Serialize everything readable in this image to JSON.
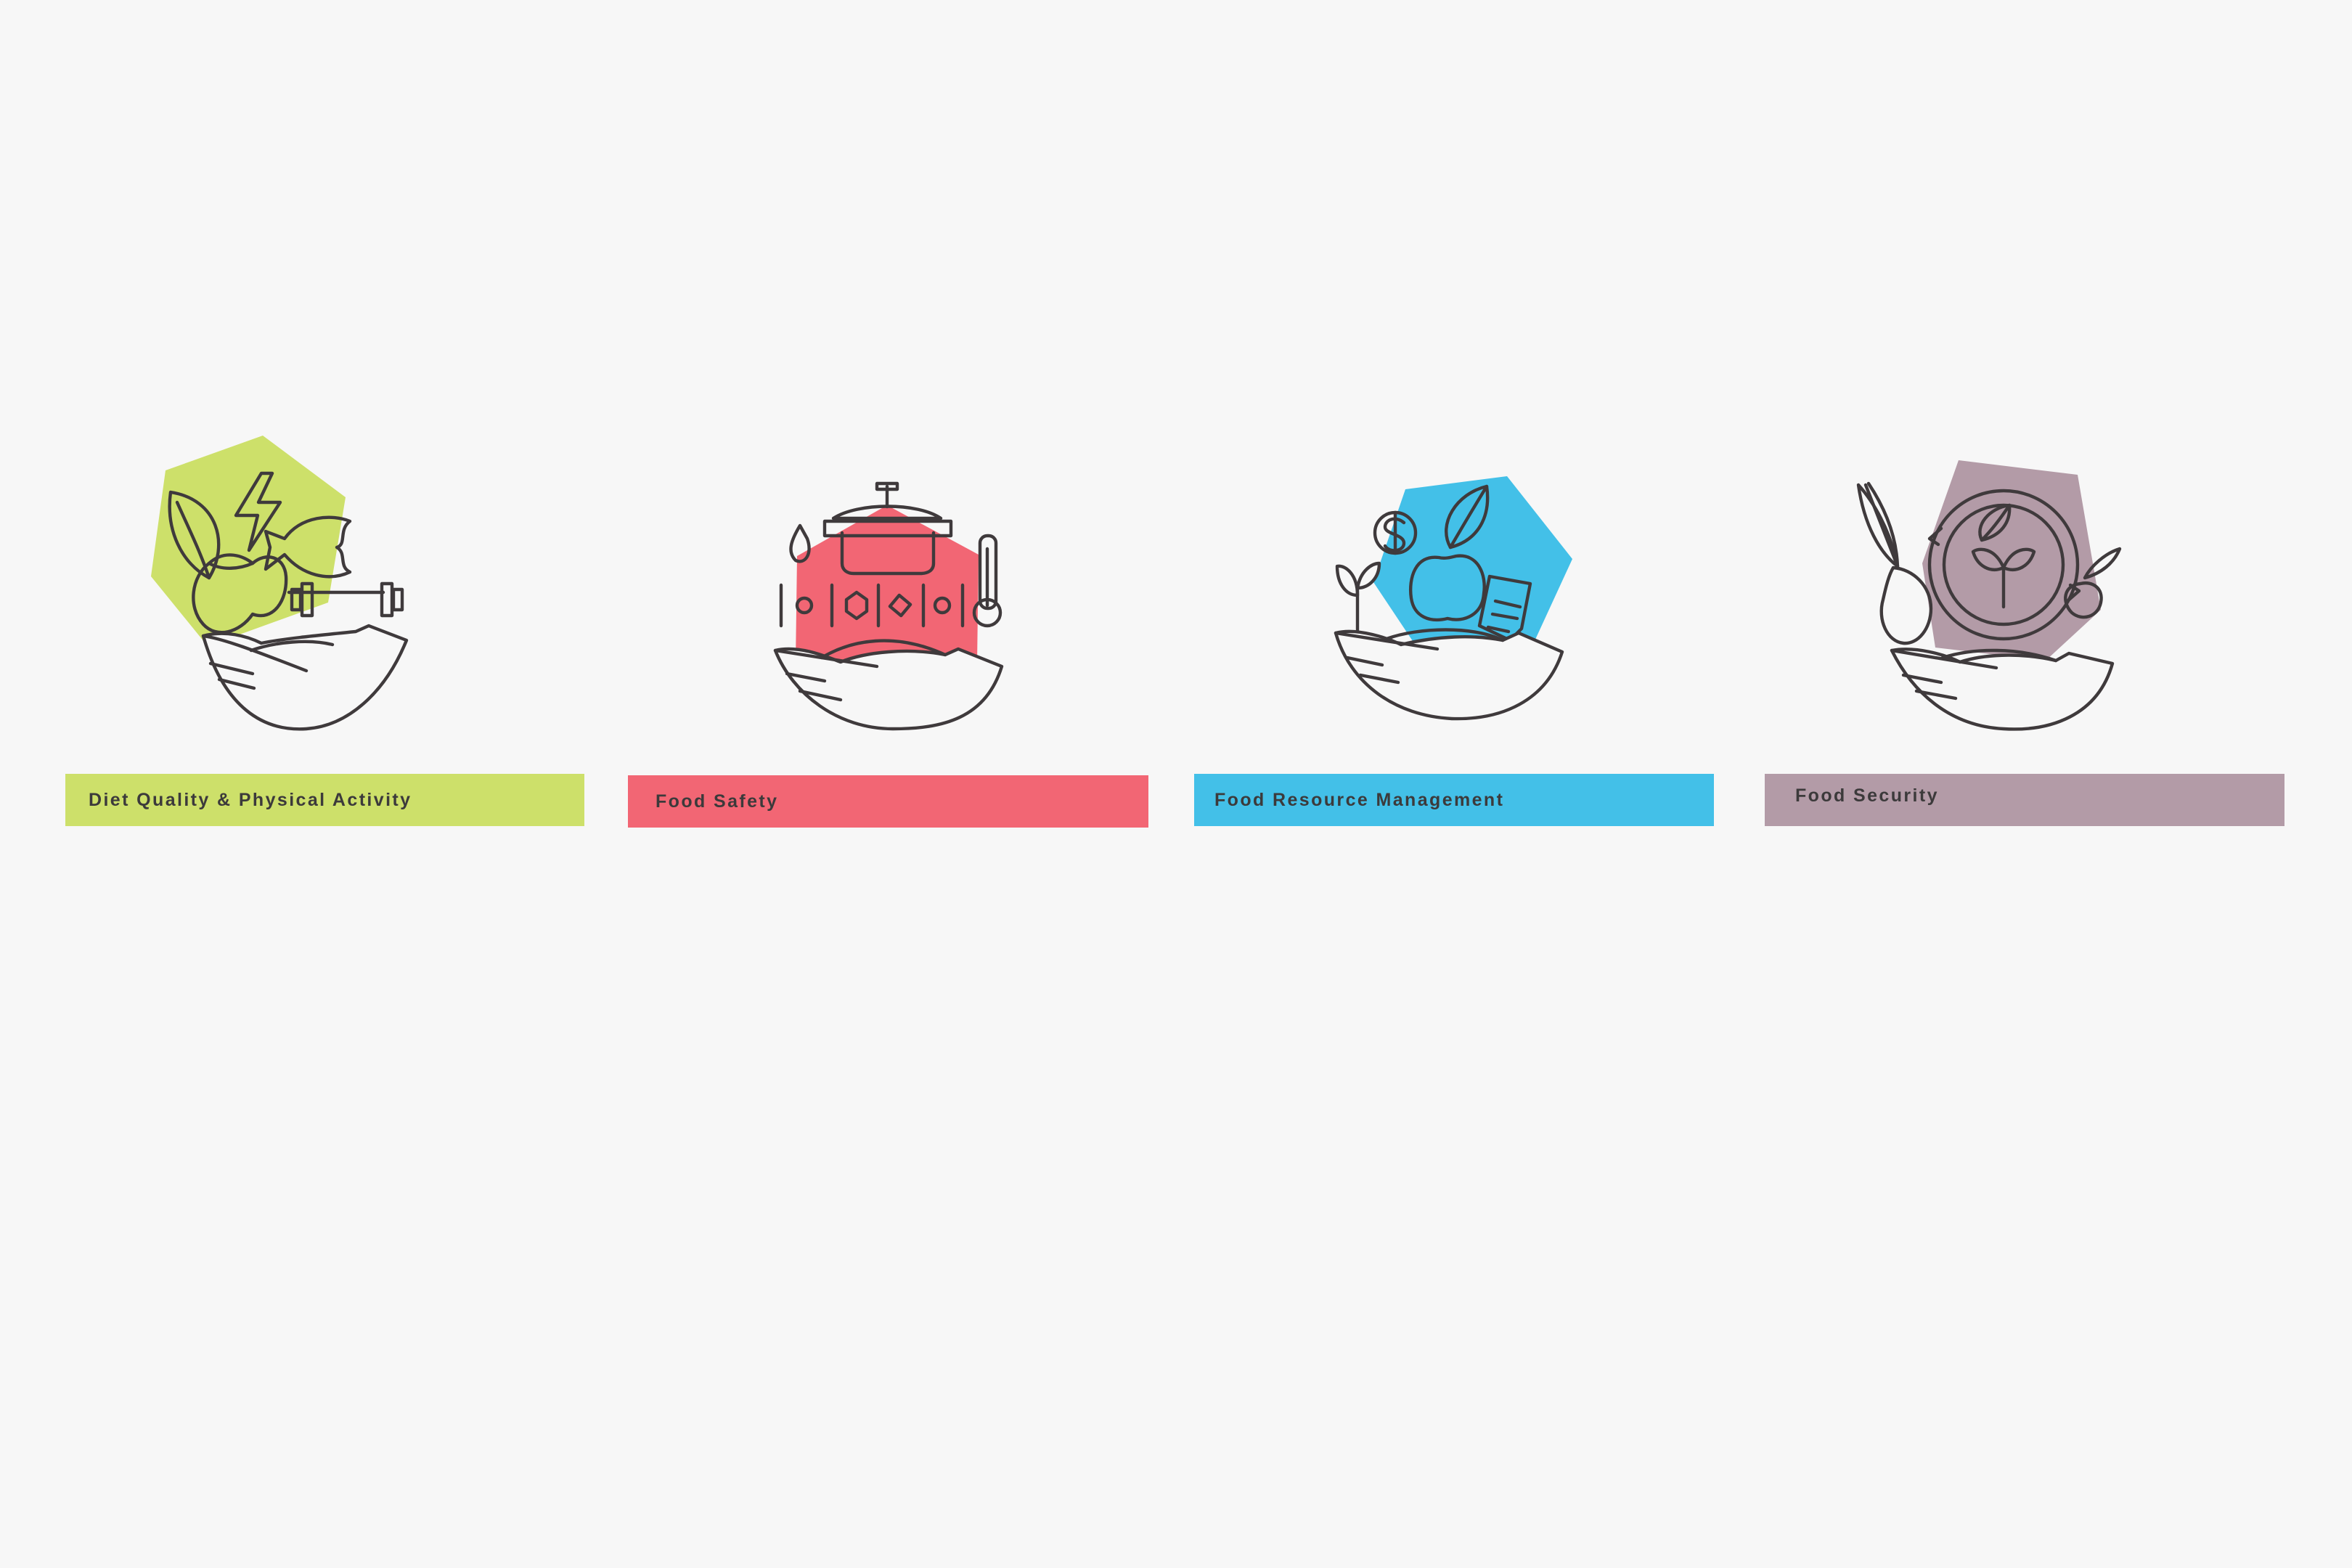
{
  "categories": [
    {
      "label": "Diet Quality & Physical Activity",
      "color": "#cde06a",
      "icon": "diet-activity-icon"
    },
    {
      "label": "Food Safety",
      "color": "#f26674",
      "icon": "food-safety-icon"
    },
    {
      "label": "Food Resource Management",
      "color": "#43c0e8",
      "icon": "resource-management-icon"
    },
    {
      "label": "Food Security",
      "color": "#b39ba7",
      "icon": "food-security-icon"
    }
  ],
  "icon_stroke_color": "#3f3a3c",
  "background_color": "#f7f7f7"
}
